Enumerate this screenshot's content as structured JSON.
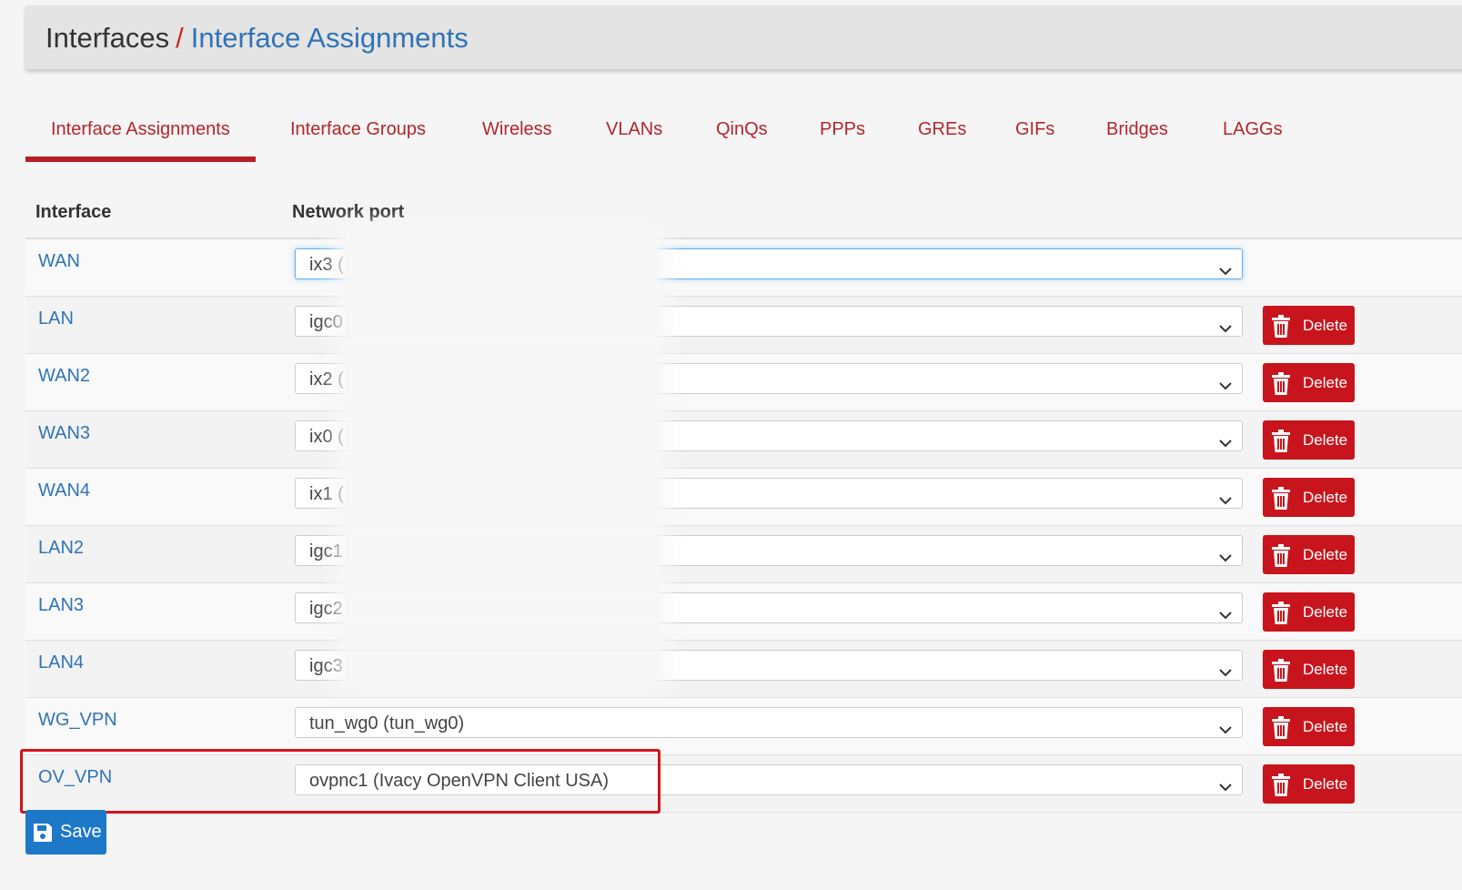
{
  "breadcrumb": {
    "root": "Interfaces",
    "separator": "/",
    "current": "Interface Assignments"
  },
  "tabs": [
    {
      "label": "Interface Assignments",
      "active": true
    },
    {
      "label": "Interface Groups"
    },
    {
      "label": "Wireless"
    },
    {
      "label": "VLANs"
    },
    {
      "label": "QinQs"
    },
    {
      "label": "PPPs"
    },
    {
      "label": "GREs"
    },
    {
      "label": "GIFs"
    },
    {
      "label": "Bridges"
    },
    {
      "label": "LAGGs"
    }
  ],
  "table": {
    "headers": {
      "interface": "Interface",
      "network_port": "Network port"
    },
    "rows": [
      {
        "interface": "WAN",
        "port": "ix3 (",
        "delete": null
      },
      {
        "interface": "LAN",
        "port": "igc0",
        "delete": "Delete"
      },
      {
        "interface": "WAN2",
        "port": "ix2 (",
        "delete": "Delete"
      },
      {
        "interface": "WAN3",
        "port": "ix0 (",
        "delete": "Delete"
      },
      {
        "interface": "WAN4",
        "port": "ix1 (",
        "delete": "Delete"
      },
      {
        "interface": "LAN2",
        "port": "igc1",
        "delete": "Delete"
      },
      {
        "interface": "LAN3",
        "port": "igc2",
        "delete": "Delete"
      },
      {
        "interface": "LAN4",
        "port": "igc3",
        "delete": "Delete"
      },
      {
        "interface": "WG_VPN",
        "port": "tun_wg0 (tun_wg0)",
        "delete": "Delete"
      },
      {
        "interface": "OV_VPN",
        "port": "ovpnc1 (Ivacy OpenVPN Client USA)",
        "delete": "Delete"
      }
    ]
  },
  "save_label": "Save",
  "colors": {
    "link": "#2f73b7",
    "tab": "#b3262a",
    "delete": "#c8141c",
    "save": "#1e78c8",
    "highlight": "#d4141c"
  },
  "icons": {
    "delete": "trash-icon",
    "select": "chevron-down-icon",
    "save": "floppy-disk-icon"
  }
}
